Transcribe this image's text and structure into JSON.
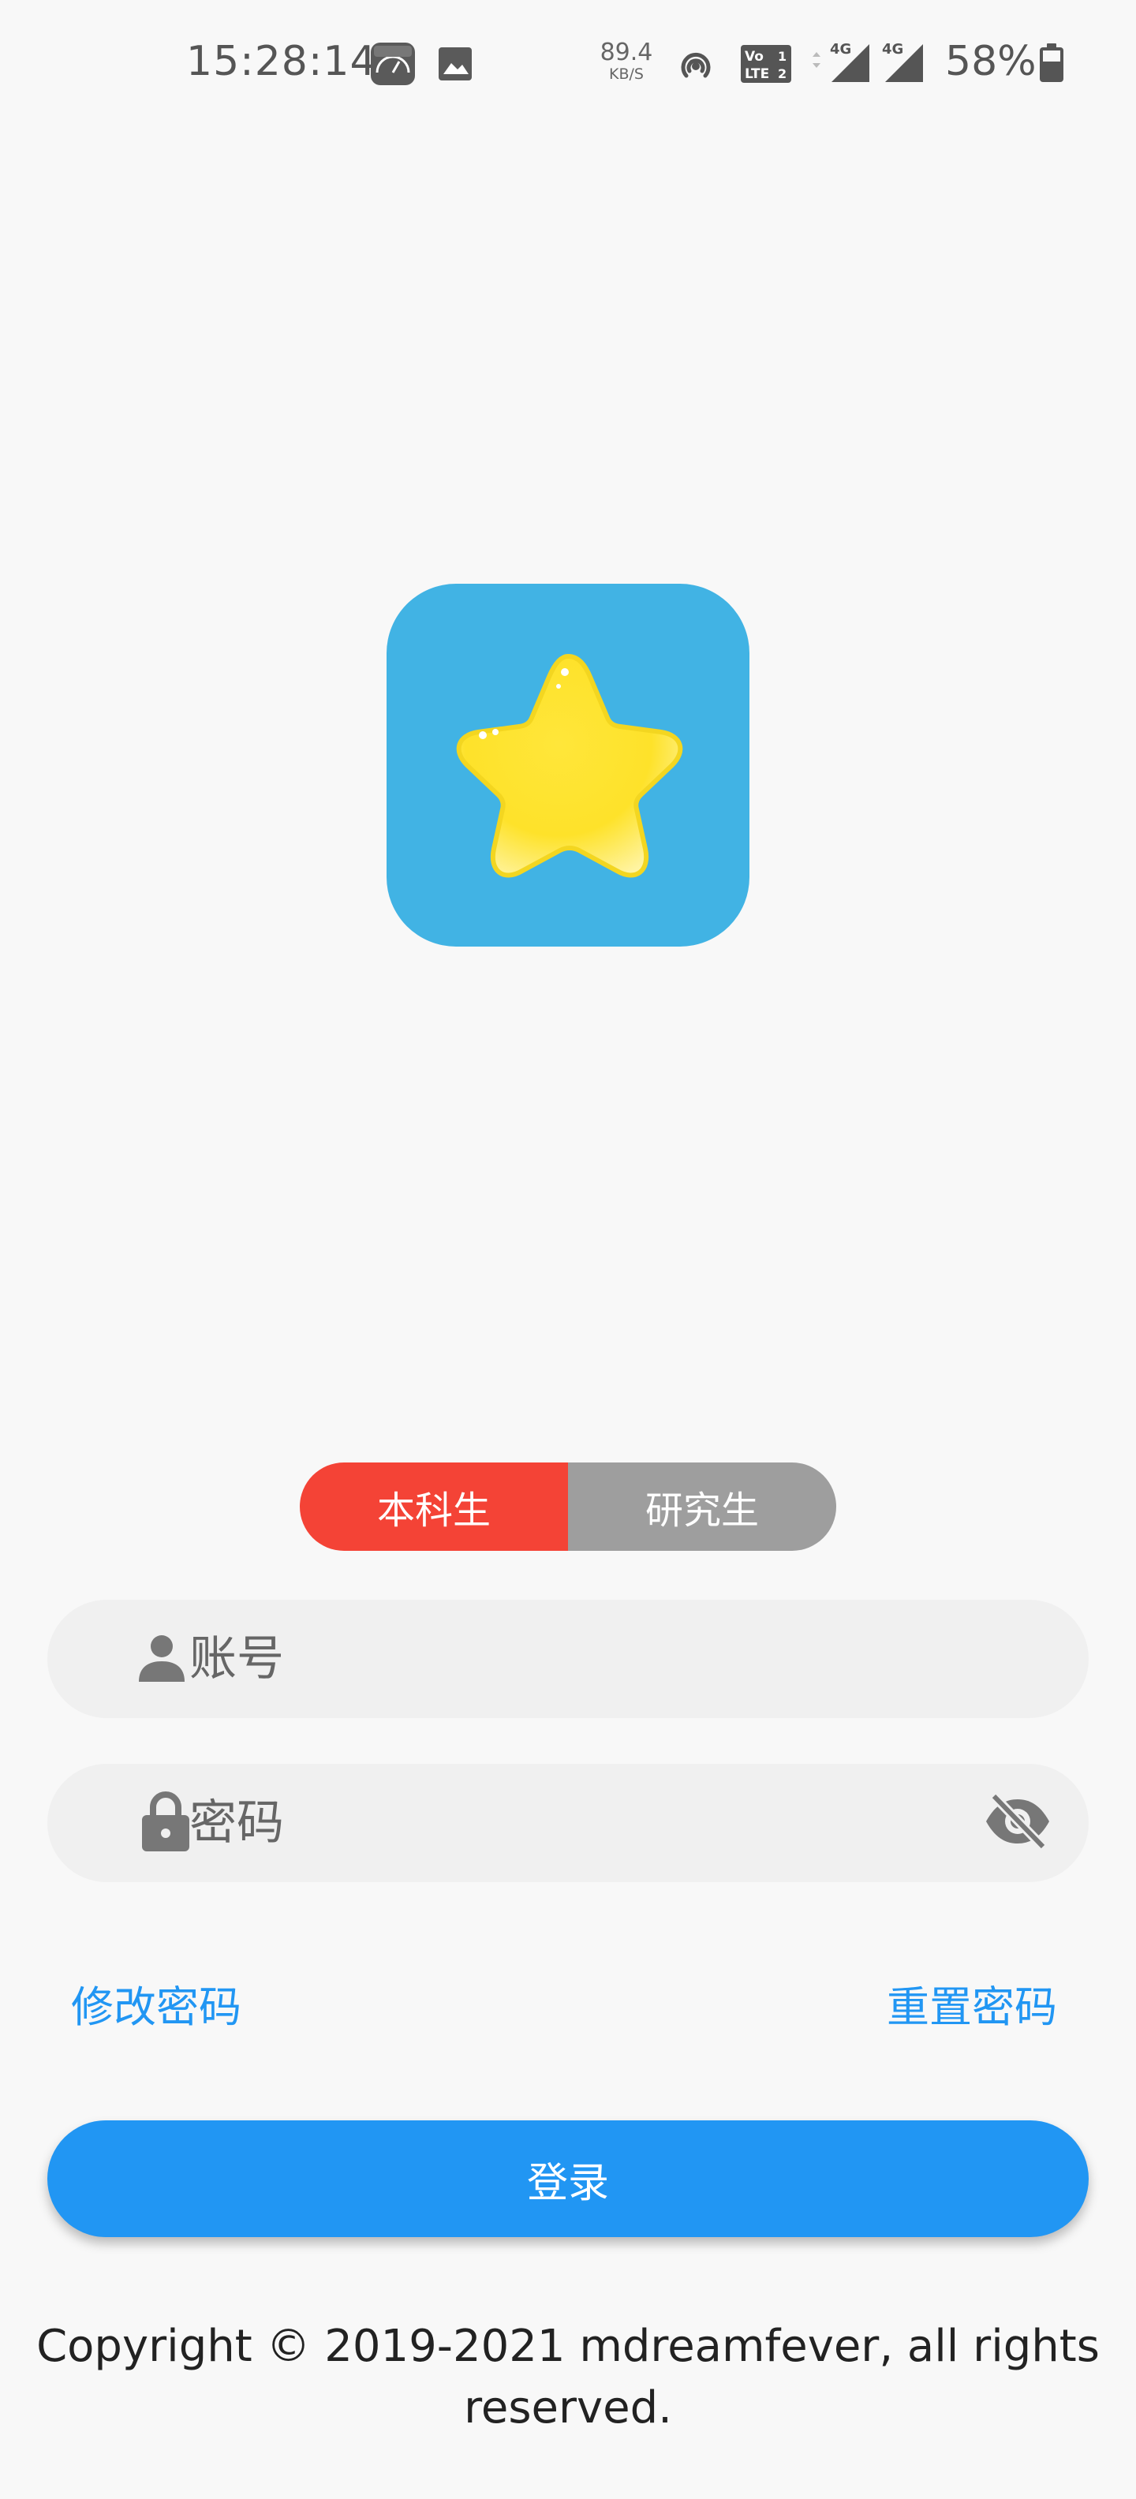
{
  "status_bar": {
    "time": "15:28:14",
    "network_speed_value": "89.4",
    "network_speed_unit": "KB/S",
    "signal_1_label": "4G",
    "signal_2_label": "4G",
    "volte_label": "VoLTE",
    "battery_percent": "58%",
    "icons": [
      "speedometer-app-icon",
      "gallery-icon",
      "hotspot-icon",
      "volte-icon",
      "signal-icon",
      "signal-icon",
      "battery-icon"
    ]
  },
  "logo": {
    "icon": "star-icon",
    "background_color": "#41b3e4"
  },
  "segment": {
    "options": [
      {
        "label": "本科生",
        "selected": true
      },
      {
        "label": "研究生",
        "selected": false
      }
    ],
    "active_color": "#f44336",
    "inactive_color": "#9e9e9e"
  },
  "form": {
    "account_placeholder": "账号",
    "password_placeholder": "密码",
    "account_icon": "person-icon",
    "password_icon": "lock-icon",
    "visibility_icon": "eye-off-icon"
  },
  "links": {
    "change_password": "修改密码",
    "reset_password": "重置密码"
  },
  "login_button": {
    "label": "登录",
    "color": "#2196f3"
  },
  "footer": {
    "copyright_line1": "Copyright © 2019-2021 mdreamfever, all rights",
    "copyright_line2": "reserved."
  }
}
